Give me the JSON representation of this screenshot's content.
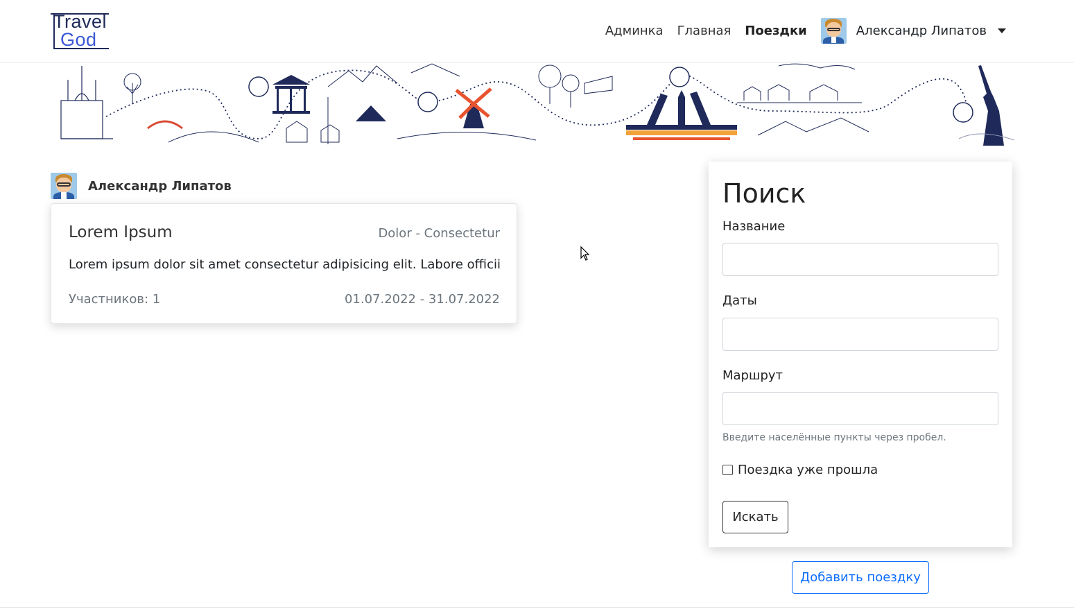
{
  "brand": {
    "logo_line1": "Travel",
    "logo_line2": "God"
  },
  "nav": {
    "items": [
      {
        "label": "Админка"
      },
      {
        "label": "Главная"
      },
      {
        "label": "Поездки"
      }
    ],
    "user_name": "Александр Липатов"
  },
  "trips": {
    "owner_name": "Александр Липатов",
    "card": {
      "title": "Lorem Ipsum",
      "route": "Dolor - Consectetur",
      "description": "Lorem ipsum dolor sit amet consectetur adipisicing elit. Labore officiis autem",
      "members_label": "Участников:",
      "members_count": "1",
      "dates": "01.07.2022 - 31.07.2022"
    }
  },
  "search": {
    "heading": "Поиск",
    "name_label": "Название",
    "name_value": "",
    "dates_label": "Даты",
    "dates_value": "",
    "route_label": "Маршрут",
    "route_value": "",
    "route_help": "Введите населённые пункты через пробел.",
    "past_trip_label": "Поездка уже прошла",
    "past_trip_checked": false,
    "submit_label": "Искать"
  },
  "add_trip_label": "Добавить поездку",
  "colors": {
    "primary": "#0d6efd",
    "navy": "#1f2a5a",
    "muted": "#6c757d",
    "accent_orange": "#e8542f"
  }
}
